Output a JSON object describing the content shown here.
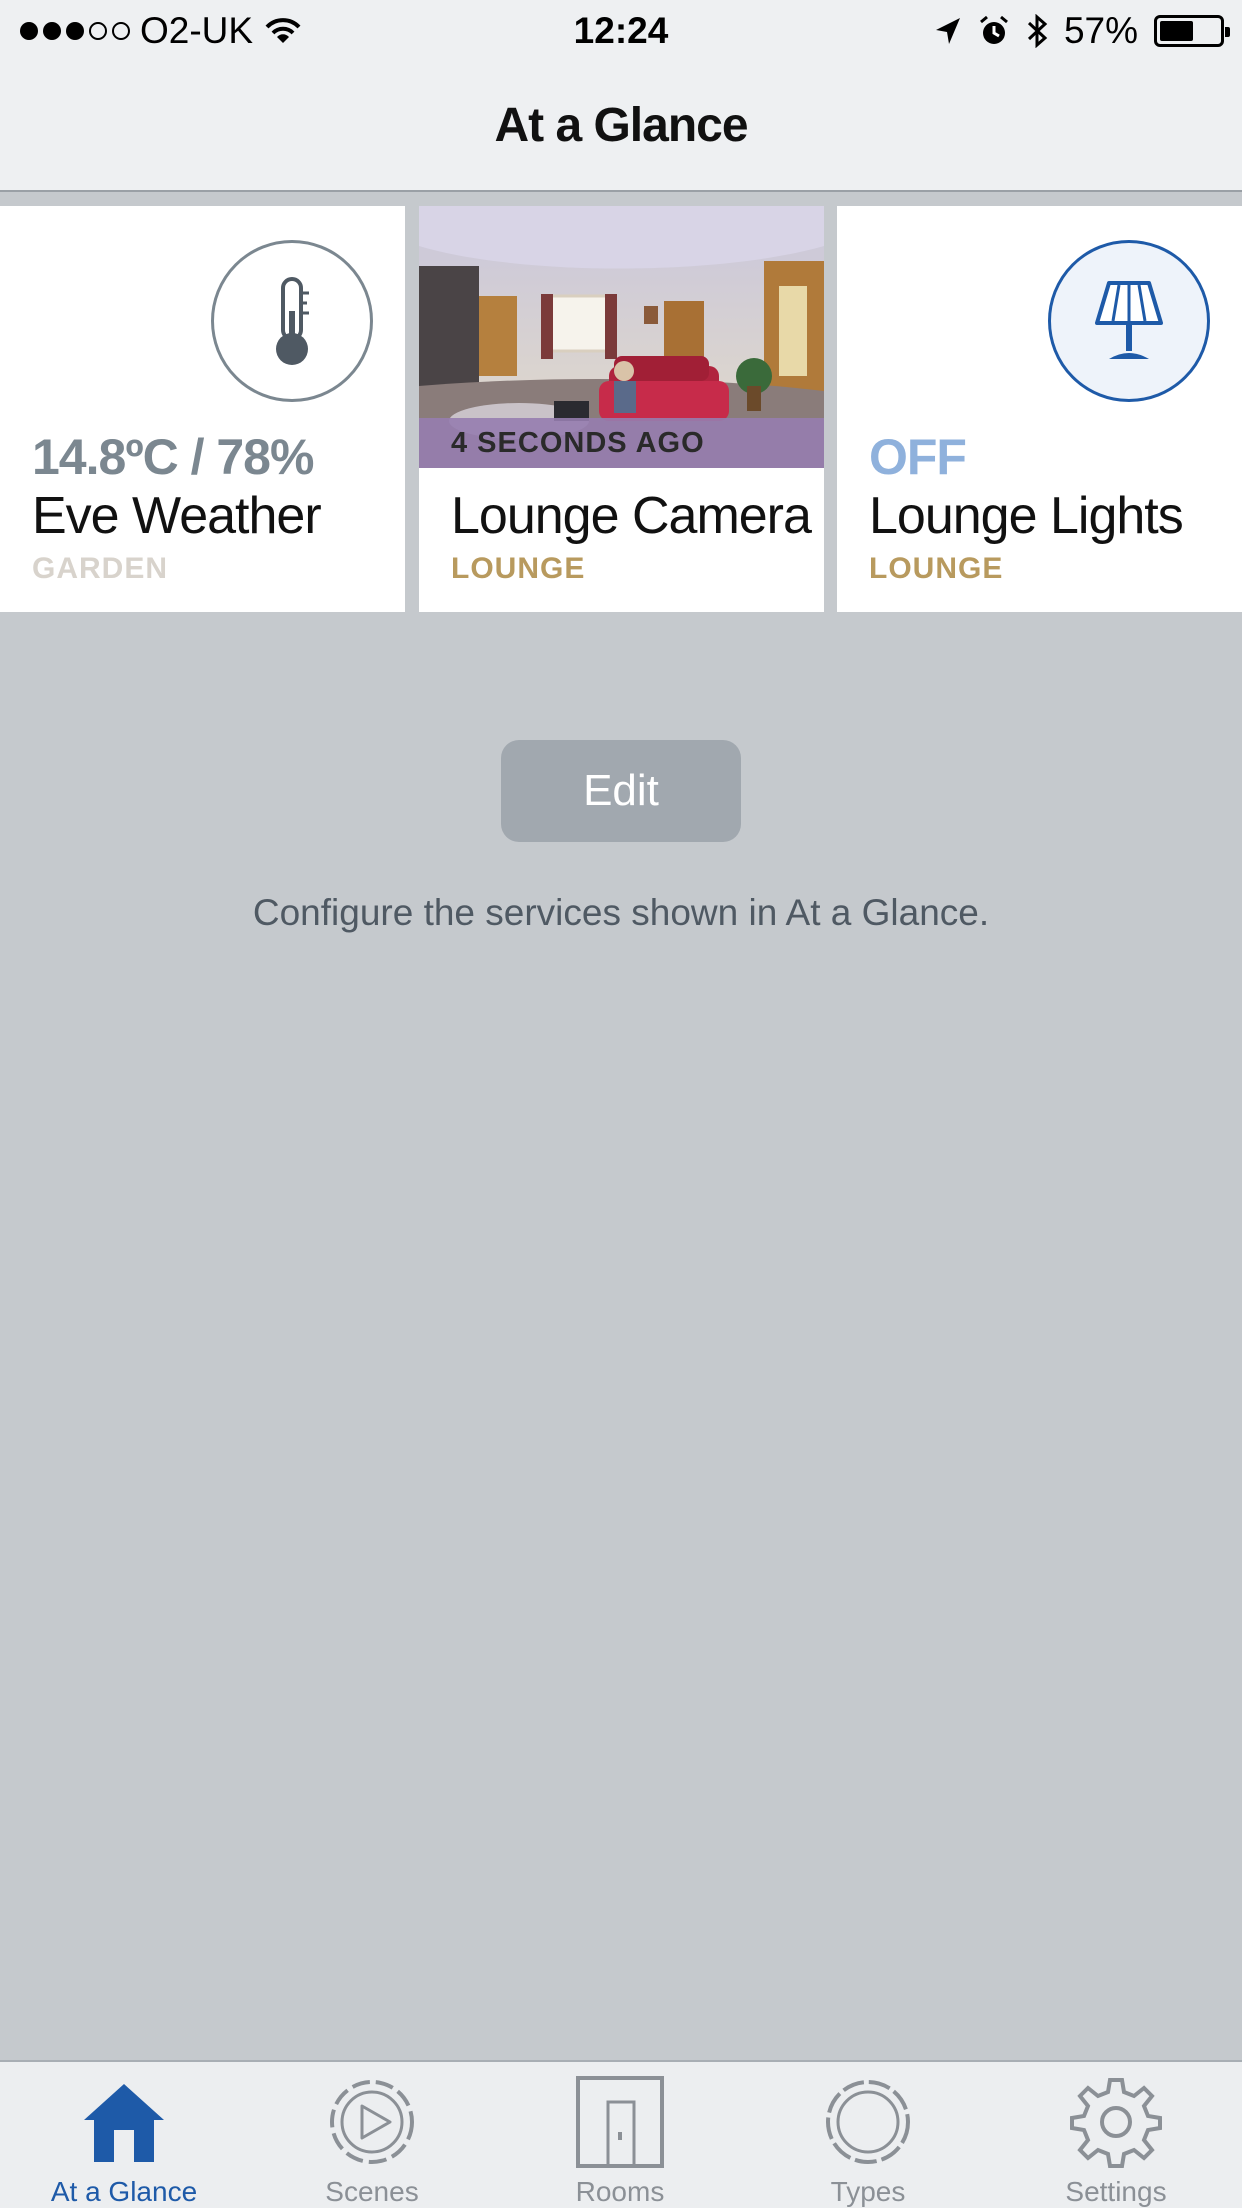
{
  "status_bar": {
    "carrier": "O2-UK",
    "time": "12:24",
    "battery": "57%",
    "battery_level": 0.57
  },
  "nav": {
    "title": "At a Glance"
  },
  "tiles": [
    {
      "status": "14.8ºC / 78%",
      "name": "Eve Weather",
      "room": "GARDEN",
      "icon": "thermometer-icon"
    },
    {
      "overlay": "4 SECONDS AGO",
      "name": "Lounge Camera",
      "room": "LOUNGE",
      "icon": "camera-snapshot"
    },
    {
      "status": "OFF",
      "name": "Lounge Lights",
      "room": "LOUNGE",
      "icon": "lamp-icon"
    }
  ],
  "edit": {
    "label": "Edit",
    "hint": "Configure the services shown in At a Glance."
  },
  "tab_bar": {
    "items": [
      {
        "label": "At a Glance",
        "icon": "home-icon",
        "active": true
      },
      {
        "label": "Scenes",
        "icon": "scenes-play-icon",
        "active": false
      },
      {
        "label": "Rooms",
        "icon": "door-icon",
        "active": false
      },
      {
        "label": "Types",
        "icon": "types-ring-icon",
        "active": false
      },
      {
        "label": "Settings",
        "icon": "gear-icon",
        "active": false
      }
    ]
  },
  "colors": {
    "accent": "#1e5aa8",
    "room_label": "#b89a5e",
    "background": "#c5c9cd"
  }
}
